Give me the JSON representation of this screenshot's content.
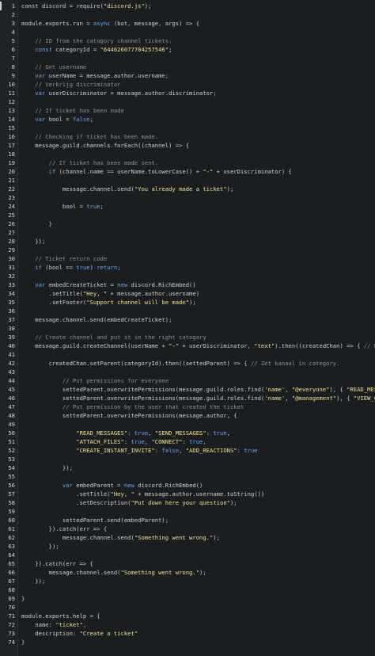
{
  "editor": {
    "lines": [
      [
        [
          "p",
          "const discord = require("
        ],
        [
          "s",
          "\"discord.js\""
        ],
        [
          "p",
          ");"
        ]
      ],
      [],
      [
        [
          "p",
          "module.exports.run = "
        ],
        [
          "k",
          "async"
        ],
        [
          "p",
          " (bot, message, args) => {"
        ]
      ],
      [],
      [
        [
          "c",
          "    // ID from the catogory channel tickets."
        ]
      ],
      [
        [
          "k",
          "    const"
        ],
        [
          "p",
          " categoryId = "
        ],
        [
          "s",
          "\"644626077704257546\""
        ],
        [
          "p",
          ";"
        ]
      ],
      [],
      [
        [
          "c",
          "    // Get username"
        ]
      ],
      [
        [
          "k",
          "    var"
        ],
        [
          "p",
          " userName = message.author.username;"
        ]
      ],
      [
        [
          "c",
          "    // Verkrijg discriminator"
        ]
      ],
      [
        [
          "k",
          "    var"
        ],
        [
          "p",
          " userDiscriminator = message.author.discriminator;"
        ]
      ],
      [],
      [
        [
          "c",
          "    // If ticket has been made"
        ]
      ],
      [
        [
          "k",
          "    var"
        ],
        [
          "p",
          " bool = "
        ],
        [
          "k",
          "false"
        ],
        [
          "p",
          ";"
        ]
      ],
      [],
      [
        [
          "c",
          "    // Checking if ticket has been made."
        ]
      ],
      [
        [
          "p",
          "    message.guild.channels.forEach((channel) => {"
        ]
      ],
      [],
      [
        [
          "c",
          "        // If ticket has been made sent."
        ]
      ],
      [
        [
          "k",
          "        if"
        ],
        [
          "p",
          " (channel.name == userName.toLowerCase() + "
        ],
        [
          "s",
          "\"-\""
        ],
        [
          "p",
          " + userDiscriminator) {"
        ]
      ],
      [],
      [
        [
          "p",
          "            message.channel.send("
        ],
        [
          "s",
          "\"You already made a ticket\""
        ],
        [
          "p",
          ");"
        ]
      ],
      [],
      [
        [
          "p",
          "            bool = "
        ],
        [
          "k",
          "true"
        ],
        [
          "p",
          ";"
        ]
      ],
      [],
      [
        [
          "p",
          "        }"
        ]
      ],
      [],
      [
        [
          "p",
          "    });"
        ]
      ],
      [],
      [
        [
          "c",
          "    // Ticket return code"
        ]
      ],
      [
        [
          "k",
          "    if"
        ],
        [
          "p",
          " (bool == "
        ],
        [
          "k",
          "true"
        ],
        [
          "p",
          ") "
        ],
        [
          "k",
          "return"
        ],
        [
          "p",
          ";"
        ]
      ],
      [],
      [
        [
          "k",
          "    var"
        ],
        [
          "p",
          " embedCreateTicket = "
        ],
        [
          "k",
          "new"
        ],
        [
          "p",
          " discord.RichEmbed()"
        ]
      ],
      [
        [
          "p",
          "        .setTitle("
        ],
        [
          "s",
          "\"Hey, \""
        ],
        [
          "p",
          " + message.author.username)"
        ]
      ],
      [
        [
          "p",
          "        .setFooter("
        ],
        [
          "s",
          "\"Support channel will be made\""
        ],
        [
          "p",
          ");"
        ]
      ],
      [],
      [
        [
          "p",
          "    message.channel.send(embedCreateTicket);"
        ]
      ],
      [],
      [
        [
          "c",
          "    // Create channel and put it in the right catogary"
        ]
      ],
      [
        [
          "p",
          "    message.guild.createChannel(userName + "
        ],
        [
          "s",
          "\"-\""
        ],
        [
          "p",
          " + userDiscriminator, "
        ],
        [
          "s",
          "\"text\""
        ],
        [
          "p",
          ").then((createdChan) => { "
        ],
        [
          "c",
          "// Maak kana"
        ]
      ],
      [],
      [
        [
          "p",
          "        createdChan.setParent(categoryId).then((settedParent) => { "
        ],
        [
          "c",
          "// Zet kanaal in category."
        ]
      ],
      [],
      [
        [
          "c",
          "            // Put permissions for everyone"
        ]
      ],
      [
        [
          "p",
          "            settedParent.overwritePermissions(message.guild.roles.find("
        ],
        [
          "s",
          "'name'"
        ],
        [
          "p",
          ", "
        ],
        [
          "s",
          "\"@everyone\""
        ],
        [
          "p",
          "), { "
        ],
        [
          "s",
          "\"READ_MESSAGES\""
        ],
        [
          "p",
          ":"
        ]
      ],
      [
        [
          "p",
          "            settedParent.overwritePermissions(message.guild.roles.find("
        ],
        [
          "s",
          "'name'"
        ],
        [
          "p",
          ", "
        ],
        [
          "s",
          "\"@management\""
        ],
        [
          "p",
          "), { "
        ],
        [
          "s",
          "\"VIEW_CHANNEL\""
        ],
        [
          "p",
          ":"
        ]
      ],
      [
        [
          "c",
          "            // Put permission by the user that created the ticket"
        ]
      ],
      [
        [
          "p",
          "            settedParent.overwritePermissions(message.author, {"
        ]
      ],
      [],
      [
        [
          "s",
          "                \"READ_MESSAGES\""
        ],
        [
          "p",
          ": "
        ],
        [
          "k",
          "true"
        ],
        [
          "p",
          ", "
        ],
        [
          "s",
          "\"SEND_MESSAGES\""
        ],
        [
          "p",
          ": "
        ],
        [
          "k",
          "true"
        ],
        [
          "p",
          ","
        ]
      ],
      [
        [
          "s",
          "                \"ATTACH_FILES\""
        ],
        [
          "p",
          ": "
        ],
        [
          "k",
          "true"
        ],
        [
          "p",
          ", "
        ],
        [
          "s",
          "\"CONNECT\""
        ],
        [
          "p",
          ": "
        ],
        [
          "k",
          "true"
        ],
        [
          "p",
          ","
        ]
      ],
      [
        [
          "s",
          "                \"CREATE_INSTANT_INVITE\""
        ],
        [
          "p",
          ": "
        ],
        [
          "k",
          "false"
        ],
        [
          "p",
          ", "
        ],
        [
          "s",
          "\"ADD_REACTIONS\""
        ],
        [
          "p",
          ": "
        ],
        [
          "k",
          "true"
        ]
      ],
      [],
      [
        [
          "p",
          "            });"
        ]
      ],
      [],
      [
        [
          "k",
          "            var"
        ],
        [
          "p",
          " embedParent = "
        ],
        [
          "k",
          "new"
        ],
        [
          "p",
          " discord.RichEmbed()"
        ]
      ],
      [
        [
          "p",
          "                .setTitle("
        ],
        [
          "s",
          "\"Hey, \""
        ],
        [
          "p",
          " + message.author.username.toString())"
        ]
      ],
      [
        [
          "p",
          "                .setDescription("
        ],
        [
          "s",
          "\"Put down here your question\""
        ],
        [
          "p",
          ");"
        ]
      ],
      [],
      [
        [
          "p",
          "            settedParent.send(embedParent);"
        ]
      ],
      [
        [
          "p",
          "        }).catch(err => {"
        ]
      ],
      [
        [
          "p",
          "            message.channel.send("
        ],
        [
          "s",
          "\"Something went wrong.\""
        ],
        [
          "p",
          ");"
        ]
      ],
      [
        [
          "p",
          "        });"
        ]
      ],
      [],
      [
        [
          "p",
          "    }).catch(err => {"
        ]
      ],
      [
        [
          "p",
          "        message.channel.send("
        ],
        [
          "s",
          "\"Something went wrong.\""
        ],
        [
          "p",
          ");"
        ]
      ],
      [
        [
          "p",
          "    });"
        ]
      ],
      [],
      [
        [
          "p",
          "}"
        ]
      ],
      [],
      [
        [
          "p",
          "module.exports.help = {"
        ]
      ],
      [
        [
          "p",
          "    name: "
        ],
        [
          "s",
          "\"ticket\""
        ],
        [
          "p",
          ","
        ]
      ],
      [
        [
          "p",
          "    description: "
        ],
        [
          "s",
          "\"Create a ticket\""
        ]
      ],
      [
        [
          "p",
          "}"
        ]
      ]
    ]
  },
  "colors": {
    "background": "#1b1e21",
    "keyword": "#5fa8ff",
    "string": "#f2e28a",
    "comment": "#8b9096",
    "plain": "#cfcfcf",
    "line_number": "#d6d6d6"
  }
}
